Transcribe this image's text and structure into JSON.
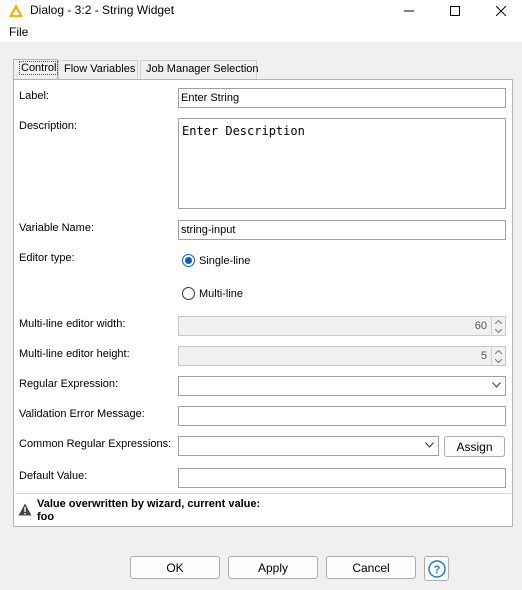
{
  "window": {
    "title": "Dialog - 3:2 - String Widget"
  },
  "menu": {
    "file": "File"
  },
  "tabs": [
    {
      "label": "Control",
      "active": true
    },
    {
      "label": "Flow Variables",
      "active": false
    },
    {
      "label": "Job Manager Selection",
      "active": false
    }
  ],
  "form": {
    "label": {
      "caption": "Label:",
      "value": "Enter String"
    },
    "description": {
      "caption": "Description:",
      "value": "Enter Description"
    },
    "variable_name": {
      "caption": "Variable Name:",
      "value": "string-input"
    },
    "editor_type": {
      "caption": "Editor type:",
      "options": [
        {
          "label": "Single-line",
          "checked": true
        },
        {
          "label": "Multi-line",
          "checked": false
        }
      ]
    },
    "multiline_width": {
      "caption": "Multi-line editor width:",
      "value": "60"
    },
    "multiline_height": {
      "caption": "Multi-line editor height:",
      "value": "5"
    },
    "regex": {
      "caption": "Regular Expression:",
      "value": ""
    },
    "validation_error": {
      "caption": "Validation Error Message:",
      "value": ""
    },
    "common_regex": {
      "caption": "Common Regular Expressions:",
      "value": "",
      "assign_label": "Assign"
    },
    "default_value": {
      "caption": "Default Value:",
      "value": ""
    }
  },
  "warning": {
    "line1": "Value overwritten by wizard, current value:",
    "line2": "foo"
  },
  "buttons": {
    "ok": "OK",
    "apply": "Apply",
    "cancel": "Cancel",
    "help": "?"
  },
  "colors": {
    "accent": "#0a5cbd",
    "app_icon": "#f5b400"
  }
}
